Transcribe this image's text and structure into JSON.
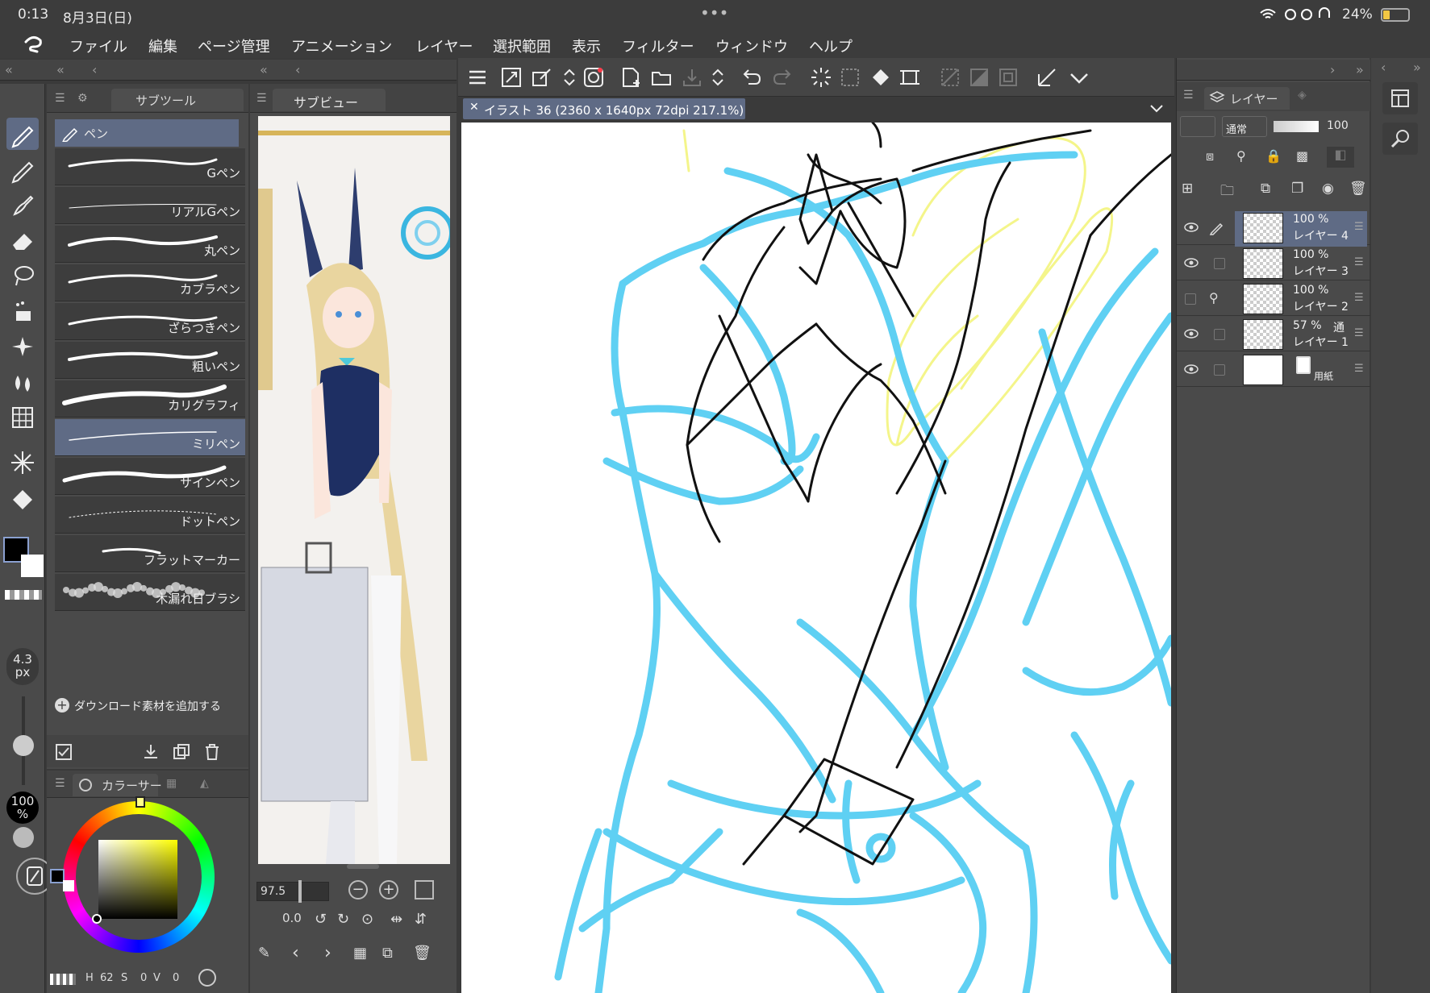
{
  "status": {
    "time": "0:13",
    "date": "8月3日(日)",
    "dots": "•••",
    "battery": "24%"
  },
  "menu": [
    "ファイル",
    "編集",
    "ページ管理",
    "アニメーション",
    "レイヤー",
    "選択範囲",
    "表示",
    "フィルター",
    "ウィンドウ",
    "ヘルプ"
  ],
  "subtool": {
    "tab_label": "サブツール",
    "group": "ペン",
    "brushes": [
      "Gペン",
      "リアルGペン",
      "丸ペン",
      "カブラペン",
      "ざらつきペン",
      "粗いペン",
      "カリグラフィ",
      "ミリペン",
      "サインペン",
      "ドットペン",
      "フラットマーカー",
      "木漏れ日ブラシ"
    ],
    "selected_index": 7,
    "add_label": "ダウンロード素材を追加する"
  },
  "brush_size": {
    "value": "4.3",
    "unit": "px"
  },
  "opacity": {
    "value": "100",
    "unit": "%"
  },
  "color_panel": {
    "tab_label": "カラーサー",
    "hsv": {
      "h": "62",
      "s": "0",
      "v": "0"
    },
    "h_label": "H",
    "s_label": "S",
    "v_label": "V"
  },
  "subview": {
    "tab_label": "サブビュー",
    "zoom": "97.5",
    "rotation": "0.0"
  },
  "document": {
    "tab_title": "イラスト 36 (2360 x 1640px 72dpi 217.1%)"
  },
  "layers": {
    "tab_label": "レイヤー",
    "blend_mode": "通常",
    "opacity": "100",
    "items": [
      {
        "name": "レイヤー 4",
        "opacity": "100 %",
        "visible": true,
        "selected": true
      },
      {
        "name": "レイヤー 3",
        "opacity": "100 %",
        "visible": true,
        "selected": false
      },
      {
        "name": "レイヤー 2",
        "opacity": "100 %",
        "visible": false,
        "selected": false
      },
      {
        "name": "レイヤー 1",
        "opacity": "57 %",
        "blend": "通",
        "visible": true,
        "selected": false
      },
      {
        "name": "",
        "paper_label": "用紙",
        "visible": true,
        "selected": false
      }
    ]
  },
  "colors": {
    "accent": "#5f6b85",
    "sketch_blue": "#5fd0f3",
    "sketch_yellow": "#f4f58a",
    "panel": "#4a4a4a"
  }
}
